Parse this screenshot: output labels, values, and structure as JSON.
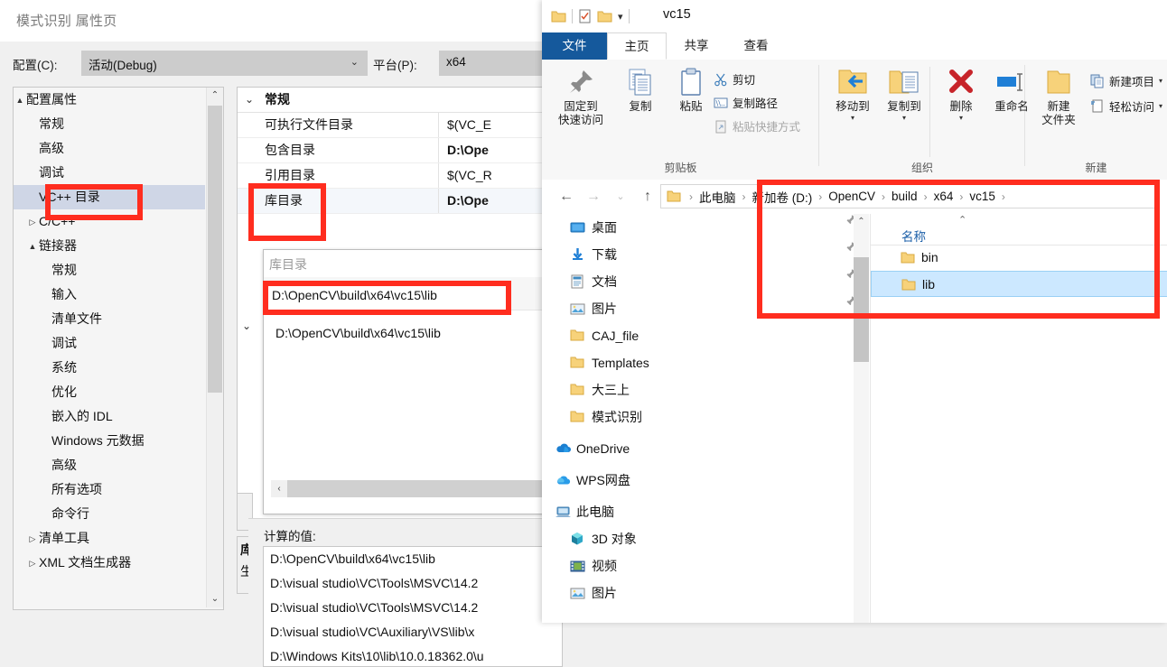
{
  "vs": {
    "title": "模式识别 属性页",
    "config_label": "配置(C):",
    "config_value": "活动(Debug)",
    "platform_label": "平台(P):",
    "platform_value": "x64",
    "tree": [
      {
        "label": "配置属性",
        "indent": 0,
        "twisty": "▲",
        "selected": false
      },
      {
        "label": "常规",
        "indent": 1,
        "twisty": "",
        "selected": false
      },
      {
        "label": "高级",
        "indent": 1,
        "twisty": "",
        "selected": false
      },
      {
        "label": "调试",
        "indent": 1,
        "twisty": "",
        "selected": false
      },
      {
        "label": "VC++ 目录",
        "indent": 1,
        "twisty": "",
        "selected": true
      },
      {
        "label": "C/C++",
        "indent": 1,
        "twisty": "▷",
        "selected": false
      },
      {
        "label": "链接器",
        "indent": 1,
        "twisty": "▲",
        "selected": false
      },
      {
        "label": "常规",
        "indent": 2,
        "twisty": "",
        "selected": false
      },
      {
        "label": "输入",
        "indent": 2,
        "twisty": "",
        "selected": false
      },
      {
        "label": "清单文件",
        "indent": 2,
        "twisty": "",
        "selected": false
      },
      {
        "label": "调试",
        "indent": 2,
        "twisty": "",
        "selected": false
      },
      {
        "label": "系统",
        "indent": 2,
        "twisty": "",
        "selected": false
      },
      {
        "label": "优化",
        "indent": 2,
        "twisty": "",
        "selected": false
      },
      {
        "label": "嵌入的 IDL",
        "indent": 2,
        "twisty": "",
        "selected": false
      },
      {
        "label": "Windows 元数据",
        "indent": 2,
        "twisty": "",
        "selected": false
      },
      {
        "label": "高级",
        "indent": 2,
        "twisty": "",
        "selected": false
      },
      {
        "label": "所有选项",
        "indent": 2,
        "twisty": "",
        "selected": false
      },
      {
        "label": "命令行",
        "indent": 2,
        "twisty": "",
        "selected": false
      },
      {
        "label": "清单工具",
        "indent": 1,
        "twisty": "▷",
        "selected": false
      },
      {
        "label": "XML 文档生成器",
        "indent": 1,
        "twisty": "▷",
        "selected": false
      }
    ],
    "grid": {
      "group": "常规",
      "group_expander": "⌄",
      "rows": [
        {
          "name": "可执行文件目录",
          "value": "$(VC_E",
          "bold": false,
          "alt": false
        },
        {
          "name": "包含目录",
          "value": "D:\\Ope",
          "bold": true,
          "alt": false
        },
        {
          "name": "引用目录",
          "value": "$(VC_R",
          "bold": false,
          "alt": false
        },
        {
          "name": "库目录",
          "value": "D:\\Ope",
          "bold": true,
          "alt": true
        }
      ]
    },
    "edit_popup": {
      "placeholder": "库目录",
      "value": "D:\\OpenCV\\build\\x64\\vc15\\lib",
      "hscroll_left": "‹"
    },
    "computed": {
      "label": "计算的值:",
      "lines": [
        "D:\\OpenCV\\build\\x64\\vc15\\lib",
        "D:\\visual studio\\VC\\Tools\\MSVC\\14.2",
        "D:\\visual studio\\VC\\Tools\\MSVC\\14.2",
        "D:\\visual studio\\VC\\Auxiliary\\VS\\lib\\x",
        "D:\\Windows Kits\\10\\lib\\10.0.18362.0\\u"
      ]
    },
    "stub": {
      "line1": "库",
      "line2": "生"
    },
    "grid_collapse_icon": "⌄"
  },
  "explorer": {
    "title": "vc15",
    "qat": [
      "folder-icon",
      "properties-icon",
      "new-folder-icon",
      "chevron-down-icon"
    ],
    "tabs": [
      {
        "label": "文件",
        "kind": "file"
      },
      {
        "label": "主页",
        "kind": "active"
      },
      {
        "label": "共享",
        "kind": "normal"
      },
      {
        "label": "查看",
        "kind": "normal"
      }
    ],
    "ribbon": {
      "groups": [
        {
          "title": "剪贴板",
          "big": [
            {
              "label": "固定到\n快速访问",
              "icon": "pin-icon"
            },
            {
              "label": "复制",
              "icon": "copy-icon"
            },
            {
              "label": "粘贴",
              "icon": "paste-icon"
            }
          ],
          "small": [
            {
              "label": "剪切",
              "icon": "scissors-icon",
              "dim": false
            },
            {
              "label": "复制路径",
              "icon": "copy-path-icon",
              "dim": false
            },
            {
              "label": "粘贴快捷方式",
              "icon": "paste-shortcut-icon",
              "dim": true
            }
          ]
        },
        {
          "title": "组织",
          "big": [
            {
              "label": "移动到",
              "icon": "move-to-icon"
            },
            {
              "label": "复制到",
              "icon": "copy-to-icon"
            },
            {
              "label": "删除",
              "icon": "delete-icon"
            },
            {
              "label": "重命名",
              "icon": "rename-icon"
            }
          ],
          "small": []
        },
        {
          "title": "新建",
          "big": [
            {
              "label": "新建\n文件夹",
              "icon": "new-folder-icon"
            }
          ],
          "small": [
            {
              "label": "新建项目",
              "icon": "new-item-icon",
              "dim": false
            },
            {
              "label": "轻松访问",
              "icon": "easy-access-icon",
              "dim": false
            }
          ]
        }
      ]
    },
    "nav_buttons": {
      "back": "←",
      "forward": "→",
      "recent": "⌄",
      "up": "↑"
    },
    "breadcrumbs": [
      "此电脑",
      "新加卷 (D:)",
      "OpenCV",
      "build",
      "x64",
      "vc15"
    ],
    "breadcrumb_separator": "›",
    "nav_items": [
      {
        "label": "桌面",
        "icon": "desktop-icon",
        "indent": 1,
        "pinned": true
      },
      {
        "label": "下载",
        "icon": "download-icon",
        "indent": 1,
        "pinned": true
      },
      {
        "label": "文档",
        "icon": "document-icon",
        "indent": 1,
        "pinned": true
      },
      {
        "label": "图片",
        "icon": "pictures-icon",
        "indent": 1,
        "pinned": true
      },
      {
        "label": "CAJ_file",
        "icon": "folder-icon",
        "indent": 1,
        "pinned": false
      },
      {
        "label": "Templates",
        "icon": "folder-icon",
        "indent": 1,
        "pinned": false
      },
      {
        "label": "大三上",
        "icon": "folder-icon",
        "indent": 1,
        "pinned": false
      },
      {
        "label": "模式识别",
        "icon": "folder-icon",
        "indent": 1,
        "pinned": false
      },
      {
        "label": "OneDrive",
        "icon": "onedrive-icon",
        "indent": 0,
        "pinned": false
      },
      {
        "label": "WPS网盘",
        "icon": "wps-cloud-icon",
        "indent": 0,
        "pinned": false
      },
      {
        "label": "此电脑",
        "icon": "this-pc-icon",
        "indent": 0,
        "pinned": false
      },
      {
        "label": "3D 对象",
        "icon": "3d-objects-icon",
        "indent": 1,
        "pinned": false
      },
      {
        "label": "视频",
        "icon": "videos-icon",
        "indent": 1,
        "pinned": false
      },
      {
        "label": "图片",
        "icon": "pictures-icon",
        "indent": 1,
        "pinned": false
      }
    ],
    "files": {
      "column_header": "名称",
      "sort_marker": "⌃",
      "rows": [
        {
          "name": "bin",
          "icon": "folder-icon",
          "selected": false
        },
        {
          "name": "lib",
          "icon": "folder-icon",
          "selected": true
        }
      ]
    }
  },
  "colors": {
    "annotation_red": "#ff2d1f",
    "file_tab_blue": "#15599c",
    "selection_blue": "#cce8ff",
    "tree_selection": "#cfd6e6"
  }
}
